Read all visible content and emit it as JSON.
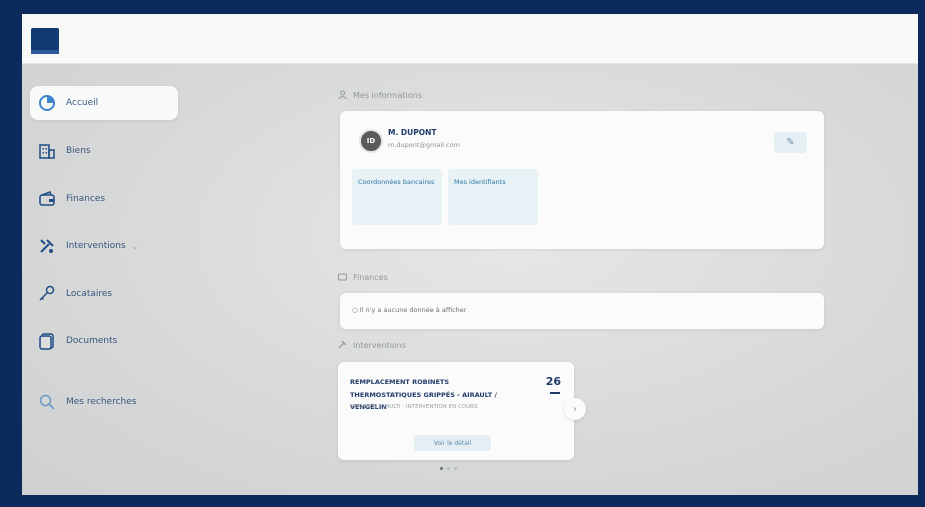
{
  "sidebar": {
    "items": [
      {
        "label": "Accueil",
        "icon": "pie-chart-icon",
        "active": true
      },
      {
        "label": "Biens",
        "icon": "building-icon"
      },
      {
        "label": "Finances",
        "icon": "wallet-icon"
      },
      {
        "label": "Interventions",
        "icon": "tools-icon"
      },
      {
        "label": "Locataires",
        "icon": "key-icon"
      },
      {
        "label": "Documents",
        "icon": "document-icon"
      },
      {
        "label": "Mes recherches",
        "icon": "search-icon"
      }
    ]
  },
  "info": {
    "section_label": "Mes informations",
    "user": {
      "initials": "ID",
      "name": "M. DUPONT",
      "email": "m.dupont@gmail.com"
    },
    "tiles": [
      "Coordonnées bancaires",
      "Mes identifiants"
    ]
  },
  "finances": {
    "section_label": "Finances",
    "empty_text": "Il n'y a aucune donnée à afficher"
  },
  "interventions": {
    "section_label": "Interventions",
    "item": {
      "title": "REMPLACEMENT ROBINETS THERMOSTATIQUES GRIPPÉS - AIRAULT / VENGELIN",
      "subtitle": "SERVICES & MULTI - INTERVENTION EN COURS",
      "day": "26",
      "button": "Voir le détail"
    }
  },
  "colors": {
    "frame": "#0d2a5c",
    "accent": "#1f3b6a",
    "tile": "#e8f1f6"
  }
}
